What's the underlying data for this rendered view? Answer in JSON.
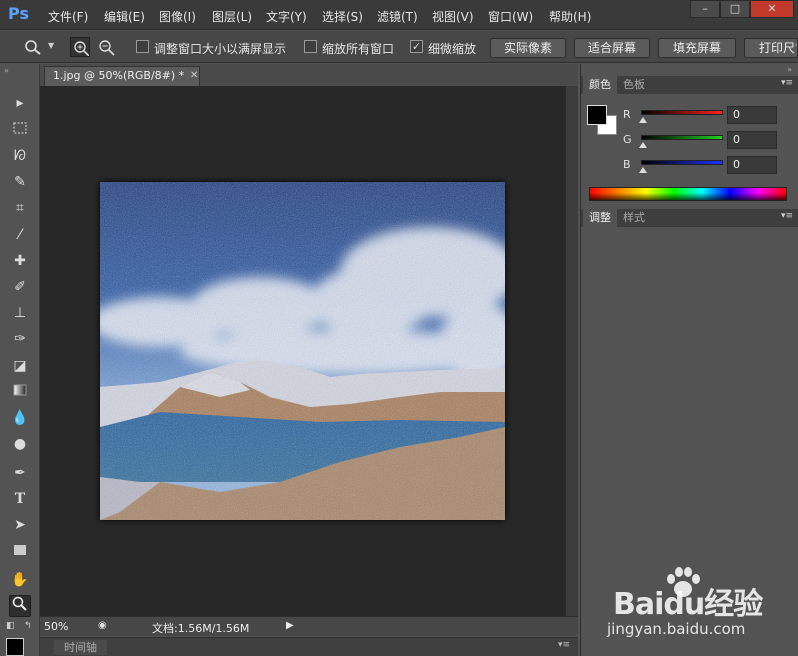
{
  "app": {
    "logo": "Ps"
  },
  "menu": [
    "文件(F)",
    "编辑(E)",
    "图像(I)",
    "图层(L)",
    "文字(Y)",
    "选择(S)",
    "滤镜(T)",
    "视图(V)",
    "窗口(W)",
    "帮助(H)"
  ],
  "window_controls": {
    "minimize": "–",
    "maximize": "□",
    "close": "✕"
  },
  "options": {
    "resize_windows": {
      "label": "调整窗口大小以满屏显示",
      "checked": false
    },
    "zoom_all": {
      "label": "缩放所有窗口",
      "checked": false
    },
    "scrubby_zoom": {
      "label": "细微缩放",
      "checked": true
    },
    "buttons": [
      "实际像素",
      "适合屏幕",
      "填充屏幕",
      "打印尺寸"
    ]
  },
  "document": {
    "tab_title": "1.jpg @ 50%(RGB/8#) *",
    "zoom": "50%",
    "doc_info": "文档:1.56M/1.56M"
  },
  "timeline": {
    "label": "时间轴"
  },
  "color_panel": {
    "tabs": [
      "颜色",
      "色板"
    ],
    "channels": [
      {
        "name": "R",
        "value": "0",
        "color": "#e03030"
      },
      {
        "name": "G",
        "value": "0",
        "color": "#30c030"
      },
      {
        "name": "B",
        "value": "0",
        "color": "#3040e0"
      }
    ],
    "foreground": "#000000",
    "background": "#ffffff"
  },
  "adjust_panel": {
    "tabs": [
      "调整",
      "样式"
    ]
  },
  "watermark": {
    "main": "Baidu经验",
    "url": "jingyan.baidu.com"
  }
}
